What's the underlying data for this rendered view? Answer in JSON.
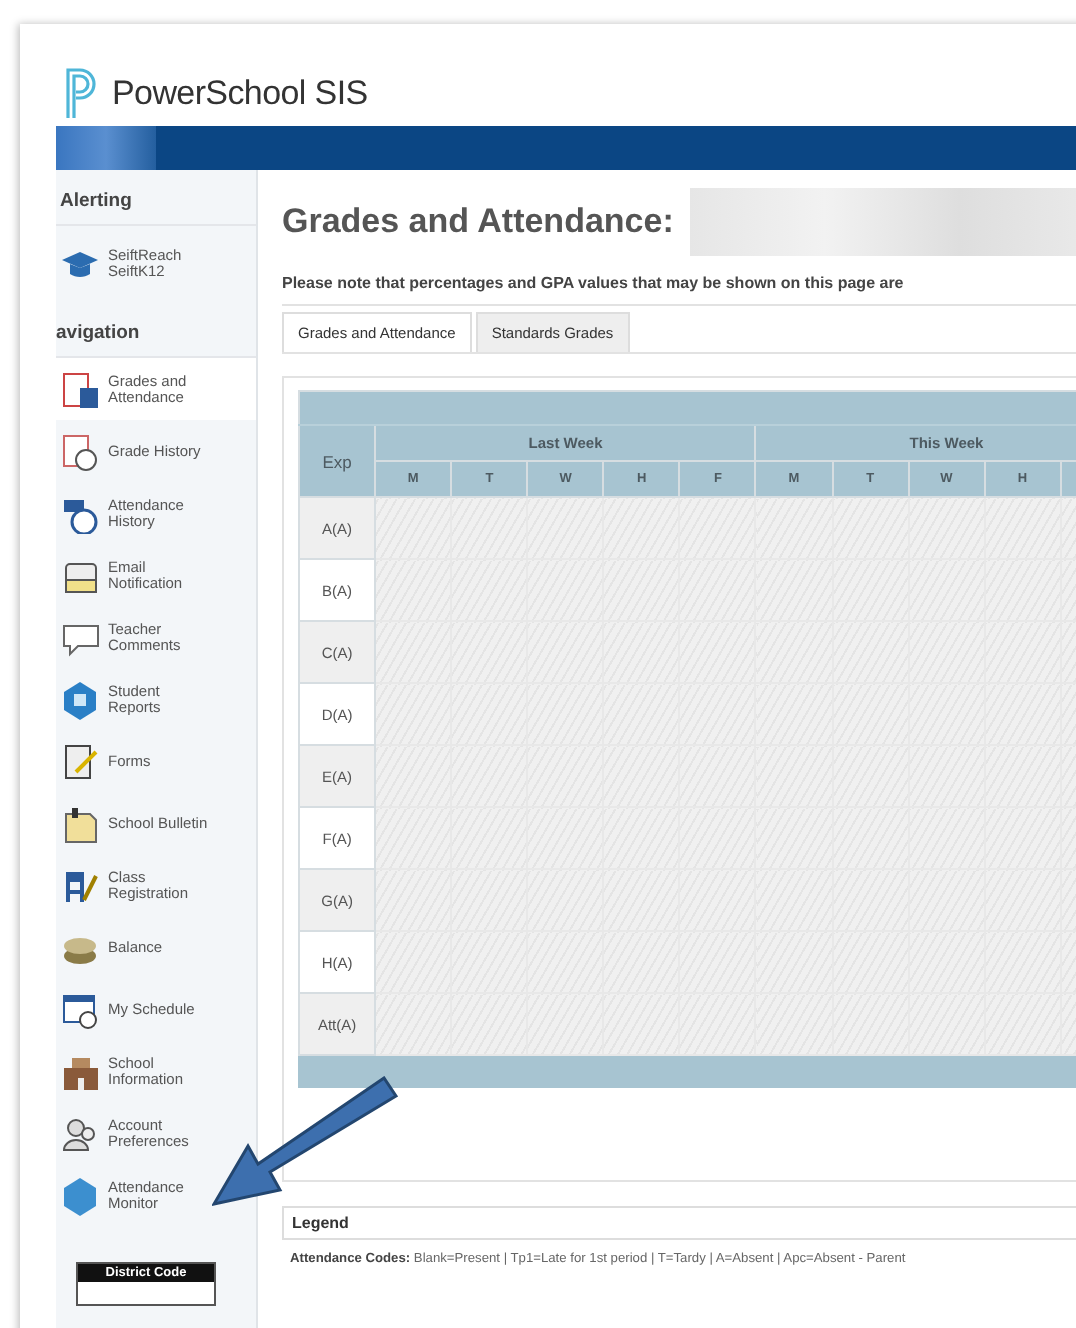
{
  "app": {
    "title": "PowerSchool SIS"
  },
  "sidebar": {
    "alerting": {
      "heading": "Alerting",
      "items": [
        {
          "lines": [
            "SeiftReach",
            "SeiftK12"
          ]
        }
      ]
    },
    "navigation": {
      "heading": "avigation",
      "items": [
        {
          "lines": [
            "Grades and",
            "Attendance"
          ],
          "selected": true
        },
        {
          "lines": [
            "Grade History"
          ],
          "selected": false
        },
        {
          "lines": [
            "Attendance",
            "History"
          ],
          "selected": false
        },
        {
          "lines": [
            "Email",
            "Notification"
          ],
          "selected": false
        },
        {
          "lines": [
            "Teacher",
            "Comments"
          ],
          "selected": false
        },
        {
          "lines": [
            "Student",
            "Reports"
          ],
          "selected": false
        },
        {
          "lines": [
            "Forms"
          ],
          "selected": false
        },
        {
          "lines": [
            "School Bulletin"
          ],
          "selected": false
        },
        {
          "lines": [
            "Class",
            "Registration"
          ],
          "selected": false
        },
        {
          "lines": [
            "Balance"
          ],
          "selected": false
        },
        {
          "lines": [
            "My Schedule"
          ],
          "selected": false
        },
        {
          "lines": [
            "School",
            "Information"
          ],
          "selected": false
        },
        {
          "lines": [
            "Account",
            "Preferences"
          ],
          "selected": false
        },
        {
          "lines": [
            "Attendance",
            "Monitor"
          ],
          "selected": false
        }
      ]
    },
    "district_code": {
      "heading": "District Code"
    }
  },
  "main": {
    "title": "Grades and Attendance:",
    "note": "Please note that percentages and GPA values that may be shown on this page are",
    "tabs": [
      {
        "label": "Grades and Attendance",
        "selected": true
      },
      {
        "label": "Standards Grades",
        "selected": false
      }
    ],
    "table": {
      "exp_heading": "Exp",
      "weeks": [
        "Last Week",
        "This Week"
      ],
      "days": [
        "M",
        "T",
        "W",
        "H",
        "F",
        "M",
        "T",
        "W",
        "H"
      ],
      "rows": [
        "A(A)",
        "B(A)",
        "C(A)",
        "D(A)",
        "E(A)",
        "F(A)",
        "G(A)",
        "H(A)",
        "Att(A)"
      ]
    },
    "legend": {
      "heading": "Legend",
      "codes": "**Attendance Codes:**  Blank=Present | Tp1=Late for 1st period | T=Tardy | A=Absent | Apc=Absent - Parent"
    }
  }
}
